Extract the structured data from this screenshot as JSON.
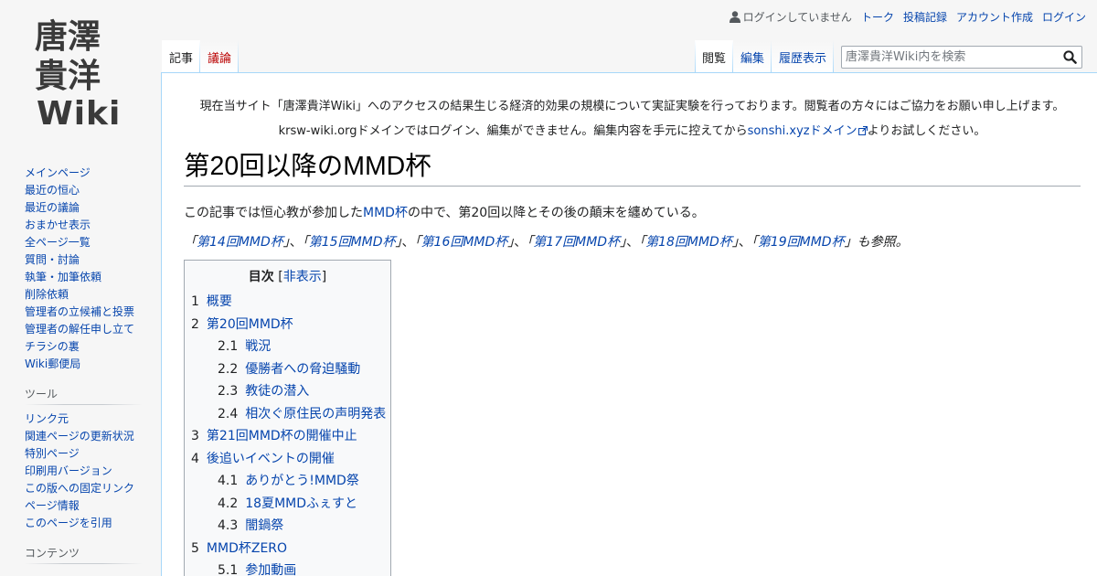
{
  "logo": {
    "line1": "唐澤",
    "line2": "貴洋",
    "line3": "Wiki"
  },
  "personal_tools": {
    "not_logged_in": "ログインしていません",
    "talk": "トーク",
    "contributions": "投稿記録",
    "create_account": "アカウント作成",
    "login": "ログイン"
  },
  "namespaces": {
    "article": "記事",
    "discussion": "議論"
  },
  "views": {
    "read": "閲覧",
    "edit": "編集",
    "history": "履歴表示"
  },
  "search": {
    "placeholder": "唐澤貴洋Wiki内を検索"
  },
  "sitenotice": {
    "line1": "現在当サイト「唐澤貴洋Wiki」へのアクセスの結果生じる経済的効果の規模について実証実験を行っております。閲覧者の方々にはご協力をお願い申し上げます。",
    "line2_pre": "krsw-wiki.orgドメインではログイン、編集ができません。編集内容を手元に控えてから",
    "line2_link": "sonshi.xyzドメイン",
    "line2_post": "よりお試しください。"
  },
  "page": {
    "title": "第20回以降のMMD杯",
    "intro_pre": "この記事では恒心教が参加した",
    "intro_link": "MMD杯",
    "intro_post": "の中で、第20回以降とその後の顛末を纏めている。",
    "see_also": [
      {
        "link": "第14回MMD杯"
      },
      {
        "link": "第15回MMD杯"
      },
      {
        "link": "第16回MMD杯"
      },
      {
        "link": "第17回MMD杯"
      },
      {
        "link": "第18回MMD杯"
      },
      {
        "link": "第19回MMD杯"
      }
    ],
    "see_also_suffix": "も参照。"
  },
  "toc": {
    "title": "目次",
    "toggle": "非表示",
    "items": [
      {
        "num": "1",
        "label": "概要",
        "children": []
      },
      {
        "num": "2",
        "label": "第20回MMD杯",
        "children": [
          {
            "num": "2.1",
            "label": "戦況"
          },
          {
            "num": "2.2",
            "label": "優勝者への脅迫騒動"
          },
          {
            "num": "2.3",
            "label": "教徒の潜入"
          },
          {
            "num": "2.4",
            "label": "相次ぐ原住民の声明発表"
          }
        ]
      },
      {
        "num": "3",
        "label": "第21回MMD杯の開催中止",
        "children": []
      },
      {
        "num": "4",
        "label": "後追いイベントの開催",
        "children": [
          {
            "num": "4.1",
            "label": "ありがとう!MMD祭"
          },
          {
            "num": "4.2",
            "label": "18夏MMDふぇすと"
          },
          {
            "num": "4.3",
            "label": "闇鍋祭"
          }
        ]
      },
      {
        "num": "5",
        "label": "MMD杯ZERO",
        "children": [
          {
            "num": "5.1",
            "label": "参加動画"
          }
        ]
      }
    ]
  },
  "sidebar": {
    "navigation": [
      "メインページ",
      "最近の恒心",
      "最近の議論",
      "おまかせ表示",
      "全ページ一覧",
      "質問・討論",
      "執筆・加筆依頼",
      "削除依頼",
      "管理者の立候補と投票",
      "管理者の解任申し立て",
      "チラシの裏",
      "Wiki郵便局"
    ],
    "tools_heading": "ツール",
    "tools": [
      "リンク元",
      "関連ページの更新状況",
      "特別ページ",
      "印刷用バージョン",
      "この版への固定リンク",
      "ページ情報",
      "このページを引用"
    ],
    "contents_heading": "コンテンツ"
  },
  "colors": {
    "link": "#0645ad",
    "new_link": "#ba0000",
    "logo_red": "#c0392b",
    "logo_dark": "#3a3a3a"
  }
}
